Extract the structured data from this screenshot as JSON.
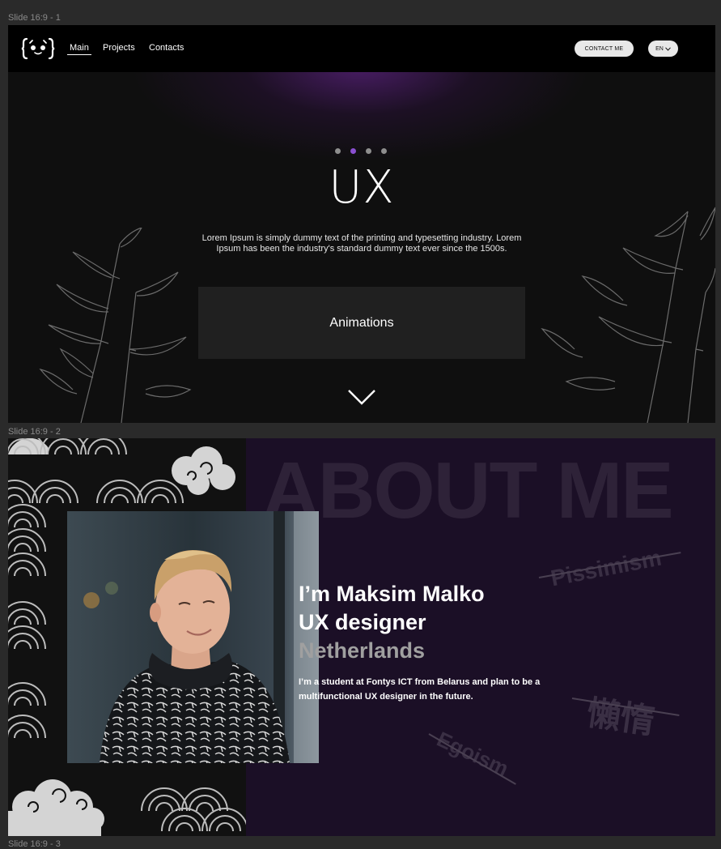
{
  "frames": {
    "slide1_label": "Slide 16:9 - 1",
    "slide2_label": "Slide 16:9 - 2",
    "slide3_label": "Slide 16:9 - 3"
  },
  "nav": {
    "items": [
      {
        "label": "Main",
        "active": true
      },
      {
        "label": "Projects",
        "active": false
      },
      {
        "label": "Contacts",
        "active": false
      }
    ],
    "contact_label": "CONTACT ME",
    "lang_label": "EN"
  },
  "hero": {
    "carousel_active_index": 1,
    "carousel_count": 4,
    "title": "UX",
    "text": "Lorem Ipsum is simply dummy text of the printing and typesetting industry. Lorem Ipsum has been the industry's standard dummy text ever since the 1500s.",
    "button_label": "Animations"
  },
  "about": {
    "bg_title": "ABOUT ME",
    "line1": "I’m Maksim Malko",
    "line2": "UX designer",
    "line3": "Netherlands",
    "bio": "I’m a student at Fontys ICT from Belarus and plan to be a multifunctional UX designer in the future.",
    "tags": [
      "Pissimism",
      "懶惰",
      "Egoism"
    ]
  },
  "colors": {
    "accent": "#8a4fd1",
    "slide2_bg": "#1b0f26",
    "slide1_bg": "#0f0f0f"
  },
  "icons": {
    "logo": "panda-braces-logo",
    "down": "chevron-down-icon",
    "lang": "chevron-down-small-icon"
  }
}
